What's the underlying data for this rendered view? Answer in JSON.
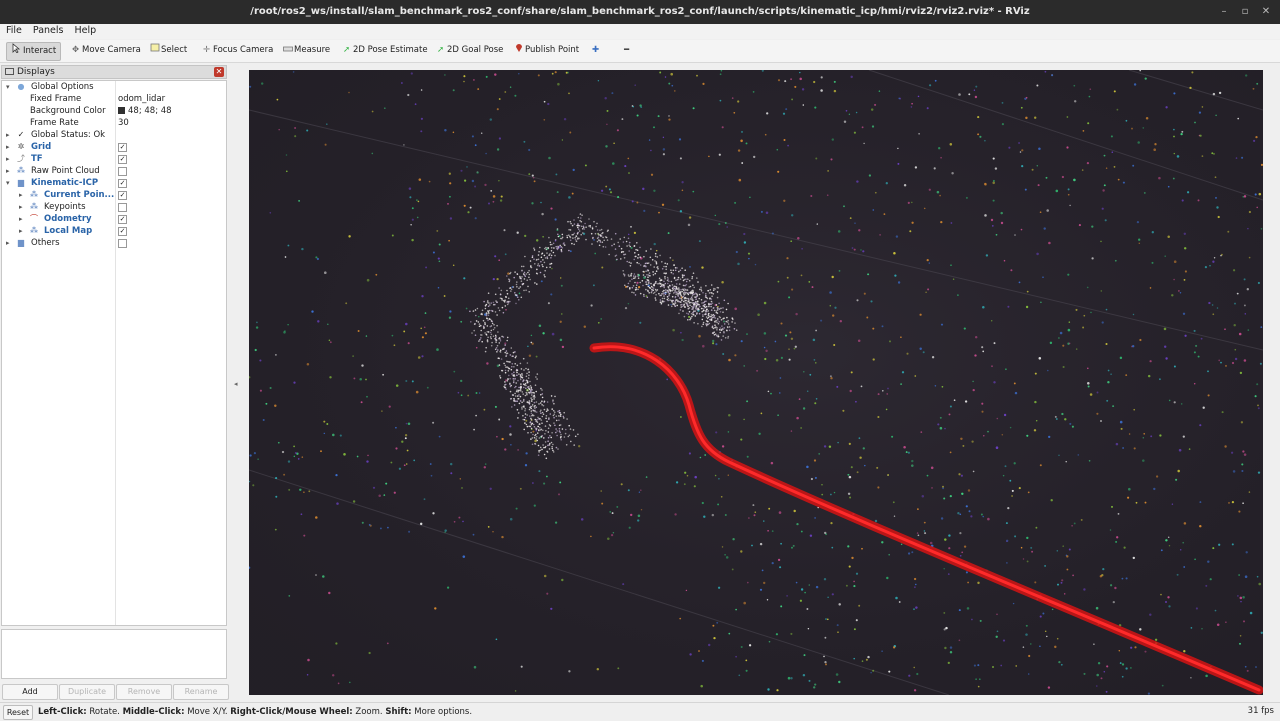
{
  "window": {
    "title": "/root/ros2_ws/install/slam_benchmark_ros2_conf/share/slam_benchmark_ros2_conf/launch/scripts/kinematic_icp/hmi/rviz2/rviz2.rviz* - RViz",
    "controls": [
      "–",
      "▫",
      "✕"
    ]
  },
  "menu": [
    "File",
    "Panels",
    "Help"
  ],
  "toolbar": {
    "interact": "Interact",
    "move_camera": "Move Camera",
    "select": "Select",
    "focus_camera": "Focus Camera",
    "measure": "Measure",
    "pose_estimate": "2D Pose Estimate",
    "goal_pose": "2D Goal Pose",
    "publish_point": "Publish Point"
  },
  "displays": {
    "title": "Displays",
    "global_options": "Global Options",
    "fixed_frame_label": "Fixed Frame",
    "fixed_frame_value": "odom_lidar",
    "background_color_label": "Background Color",
    "background_color_value": "48; 48; 48",
    "frame_rate_label": "Frame Rate",
    "frame_rate_value": "30",
    "global_status": "Global Status: Ok",
    "grid": "Grid",
    "tf": "TF",
    "raw_point_cloud": "Raw Point Cloud",
    "kinematic_icp": "Kinematic-ICP",
    "current_point": "Current Poin...",
    "keypoints": "Keypoints",
    "odometry": "Odometry",
    "local_map": "Local Map",
    "others": "Others",
    "checks": {
      "grid": true,
      "tf": true,
      "raw_point_cloud": false,
      "kinematic_icp": true,
      "current_point": true,
      "keypoints": false,
      "odometry": true,
      "local_map": true,
      "others": false
    }
  },
  "panel_buttons": {
    "add": "Add",
    "duplicate": "Duplicate",
    "remove": "Remove",
    "rename": "Rename"
  },
  "status": {
    "reset": "Reset",
    "left_click": "Left-Click:",
    "left_click_desc": "Rotate.",
    "middle_click": "Middle-Click:",
    "middle_click_desc": "Move X/Y.",
    "right_click": "Right-Click/Mouse Wheel:",
    "right_click_desc": "Zoom.",
    "shift": "Shift:",
    "shift_desc": "More options.",
    "fps": "31 fps"
  },
  "colors": {
    "trajectory": "#e01818",
    "viewport_bg": "#26222a",
    "tree_highlight": "#2a64a8"
  },
  "icons": [
    "cursor-icon",
    "move-camera-icon",
    "select-icon",
    "focus-camera-icon",
    "measure-icon",
    "pose-estimate-arrow-icon",
    "goal-pose-arrow-icon",
    "publish-point-pin-icon",
    "plus-icon",
    "minus-icon"
  ]
}
